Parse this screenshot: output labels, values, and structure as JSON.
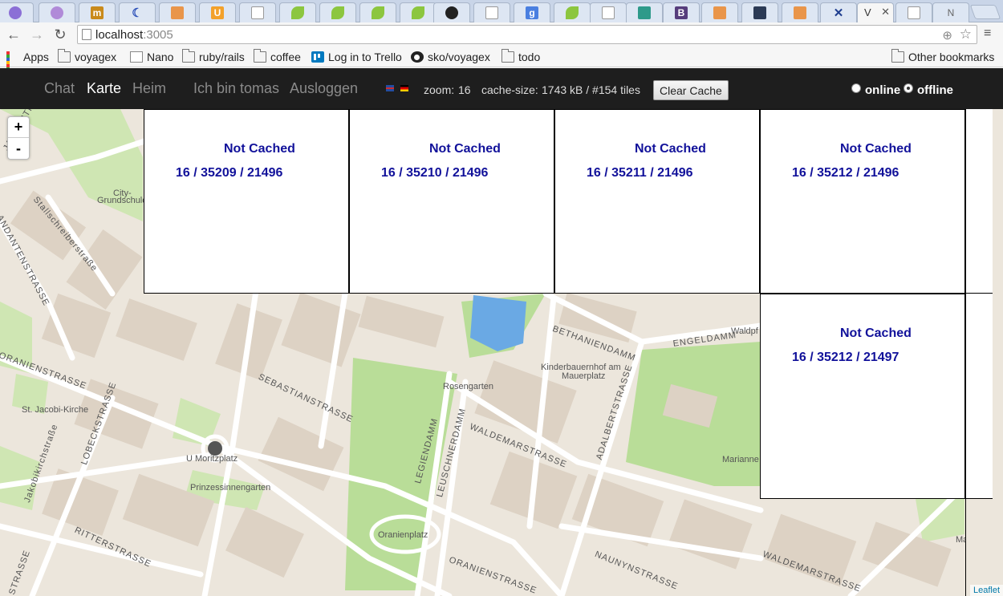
{
  "browser": {
    "active_tab_title": "V",
    "active_tab_close": "✕",
    "address": {
      "host": "localhost",
      "port": ":3005"
    },
    "nav": {
      "back": "←",
      "forward": "→",
      "reload": "↻",
      "menu": "≡",
      "star": "☆",
      "location": "⊕"
    }
  },
  "bookmarks": [
    {
      "label": "Apps",
      "icon": "apps-icon"
    },
    {
      "label": "voyagex",
      "icon": "folder-icon"
    },
    {
      "label": "Nano",
      "icon": "page-icon"
    },
    {
      "label": "ruby/rails",
      "icon": "folder-icon"
    },
    {
      "label": "coffee",
      "icon": "folder-icon"
    },
    {
      "label": "Log in to Trello",
      "icon": "trello-icon"
    },
    {
      "label": "sko/voyagex",
      "icon": "github-icon"
    },
    {
      "label": "todo",
      "icon": "folder-icon"
    }
  ],
  "other_bookmarks": "Other bookmarks",
  "appbar": {
    "nav": [
      "Chat",
      "Karte",
      "Heim"
    ],
    "active_nav": "Karte",
    "user": "Ich bin tomas",
    "logout": "Ausloggen",
    "zoom_label": "zoom:",
    "zoom_value": "16",
    "cache_label": "cache-size:",
    "cache_value": "1743 kB / #154 tiles",
    "clear_cache": "Clear Cache",
    "online_label": "online",
    "offline_label": "offline",
    "mode": "offline"
  },
  "map": {
    "zoom_in": "+",
    "zoom_out": "-",
    "attribution": "Leaflet",
    "tiles": [
      {
        "status": "Not Cached",
        "coords": "16 / 35209 / 21496"
      },
      {
        "status": "Not Cached",
        "coords": "16 / 35210 / 21496"
      },
      {
        "status": "Not Cached",
        "coords": "16 / 35211 / 21496"
      },
      {
        "status": "Not Cached",
        "coords": "16 / 35212 / 21496"
      },
      {
        "status": "Not Cached",
        "coords": "16 / 35212 / 21497"
      }
    ],
    "labels": {
      "city_grundschule_1": "City-",
      "city_grundschule_2": "Grundschule",
      "rosengarten": "Rosengarten",
      "kinderbauernhof_1": "Kinderbauernhof am",
      "kinderbauernhof_2": "Mauerplatz",
      "st_jacobi": "St. Jacobi-Kirche",
      "u_moritzplatz": "U Moritzplatz",
      "prinzessinnengarten": "Prinzessinnengarten",
      "oranienplatz": "Oranienplatz",
      "marianne": "Marianne",
      "waldpf": "Waldpf",
      "ma": "Ma"
    },
    "streets": {
      "jakobstr": "JAKOBSTR",
      "stallschreiberstrasse": "Stallschreiberstraße",
      "andantenstrasse": "ANDANTENSTRASSE",
      "oranienstrasse_w": "ORANIENSTRASSE",
      "sebastianstrasse": "SEBASTIANSTRASSE",
      "lobeckstrasse": "LOBECKSTRASSE",
      "jakobikirchstrasse": "Jakobikirchstraße",
      "ritterstrasse": "RITTERSTRASSE",
      "bethaniendamm": "BETHANIENDAMM",
      "engeldamm": "ENGELDAMM",
      "legiendamm": "LEGIENDAMM",
      "leuschnerdamm": "LEUSCHNERDAMM",
      "waldemarstrasse": "WALDEMARSTRASSE",
      "adalbertstrasse": "ADALBERTSTRASSE",
      "naunynstrasse": "NAUNYNSTRASSE",
      "oranienstrasse_e": "ORANIENSTRASSE",
      "waldemarstrasse_e": "WALDEMARSTRASSE",
      "strasse_sw": "STRASSE"
    }
  }
}
